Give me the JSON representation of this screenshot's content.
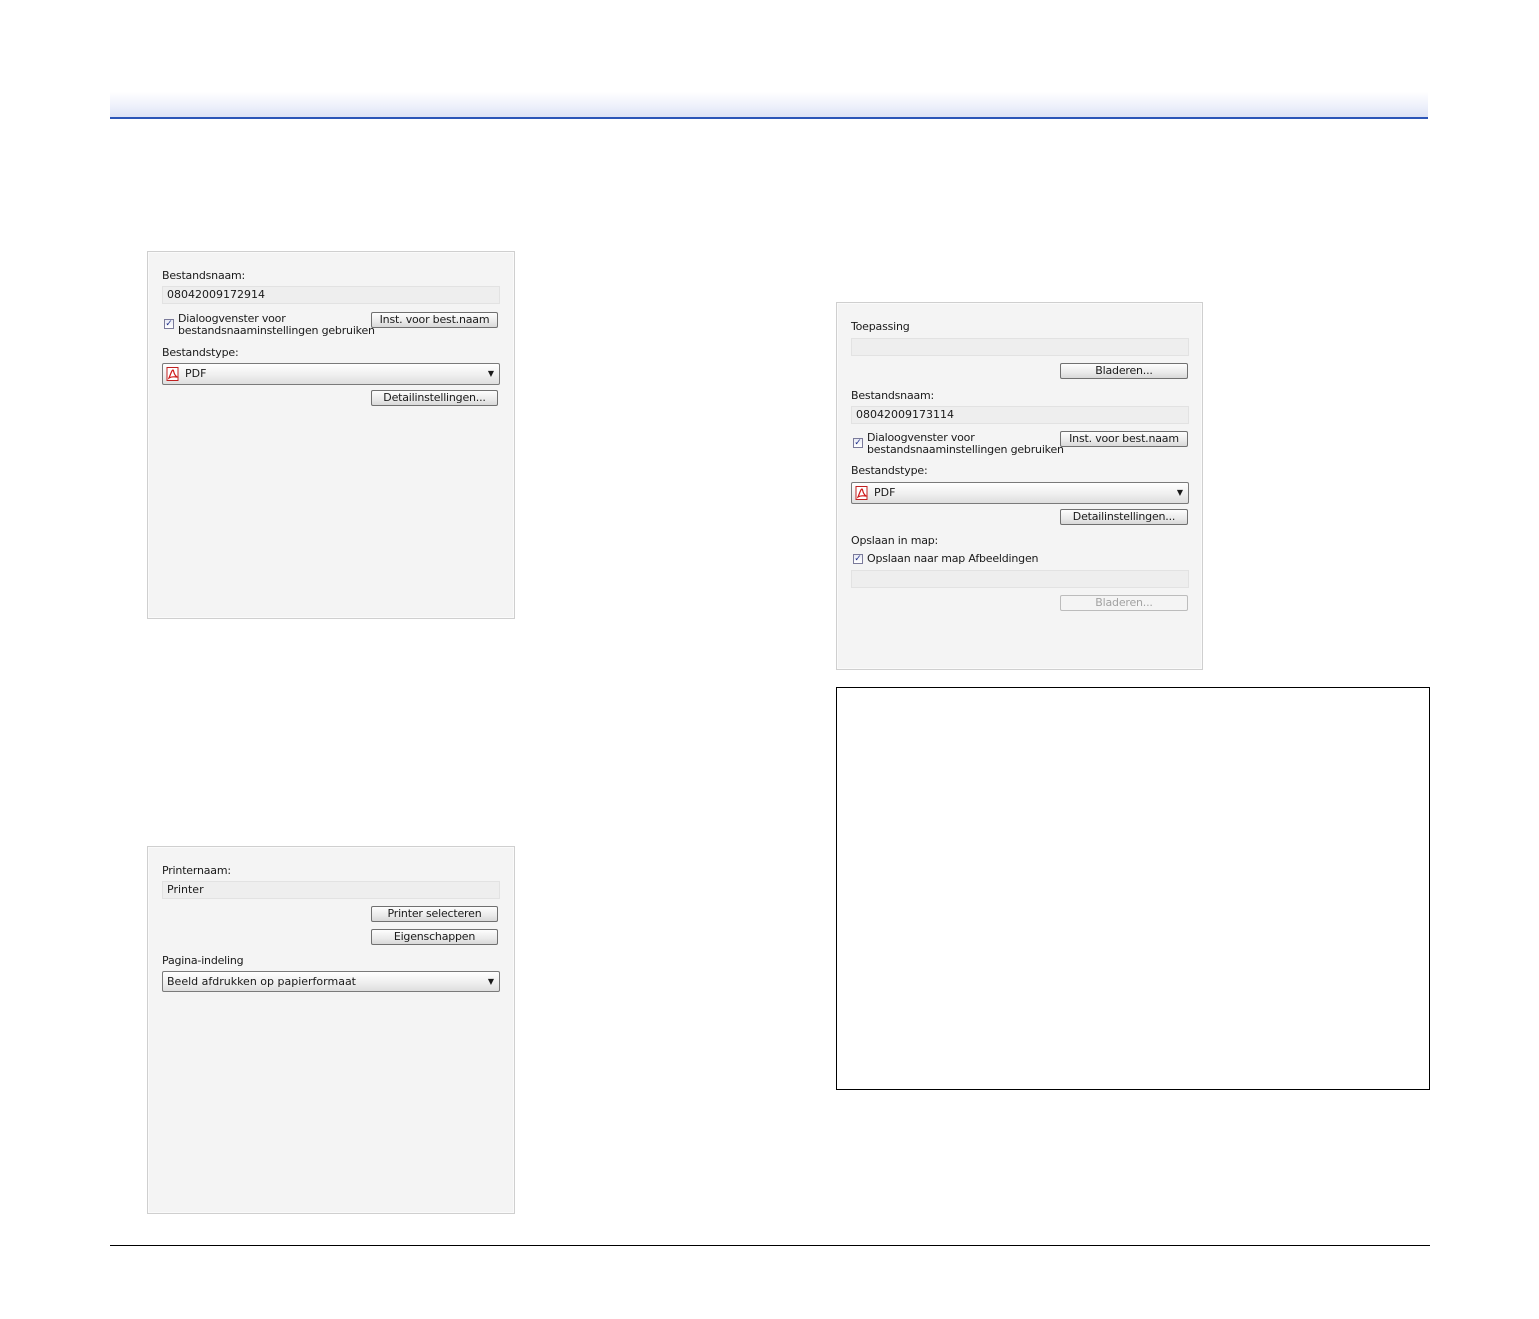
{
  "panel_save_file": {
    "filename_label": "Bestandsnaam:",
    "filename_value": "08042009172914",
    "dialog_checkbox_line1": "Dialoogvenster voor",
    "dialog_checkbox_line2": "bestandsnaaminstellingen gebruiken",
    "dialog_checked": true,
    "filename_settings_button": "Inst. voor best.naam",
    "filetype_label": "Bestandstype:",
    "filetype_value": "PDF",
    "detail_settings_button": "Detailinstellingen..."
  },
  "panel_print": {
    "printer_name_label": "Printernaam:",
    "printer_name_value": "Printer",
    "select_printer_button": "Printer selecteren",
    "properties_button": "Eigenschappen",
    "page_layout_label": "Pagina-indeling",
    "page_layout_value": "Beeld afdrukken op papierformaat"
  },
  "panel_application": {
    "application_label": "Toepassing",
    "application_value": "",
    "browse_button": "Bladeren...",
    "filename_label": "Bestandsnaam:",
    "filename_value": "08042009173114",
    "dialog_checkbox_line1": "Dialoogvenster voor",
    "dialog_checkbox_line2": "bestandsnaaminstellingen gebruiken",
    "dialog_checked": true,
    "filename_settings_button": "Inst. voor best.naam",
    "filetype_label": "Bestandstype:",
    "filetype_value": "PDF",
    "detail_settings_button": "Detailinstellingen...",
    "save_in_folder_label": "Opslaan in map:",
    "save_pictures_checkbox": "Opslaan naar map Afbeeldingen",
    "save_pictures_checked": true,
    "folder_value": "",
    "folder_browse_button": "Bladeren..."
  },
  "icons": {
    "pdf": "pdf-file-icon",
    "dropdown": "chevron-down-icon",
    "check": "checkmark-icon"
  },
  "colors": {
    "header_rule": "#2c56b8",
    "panel_bg": "#f4f4f4"
  }
}
